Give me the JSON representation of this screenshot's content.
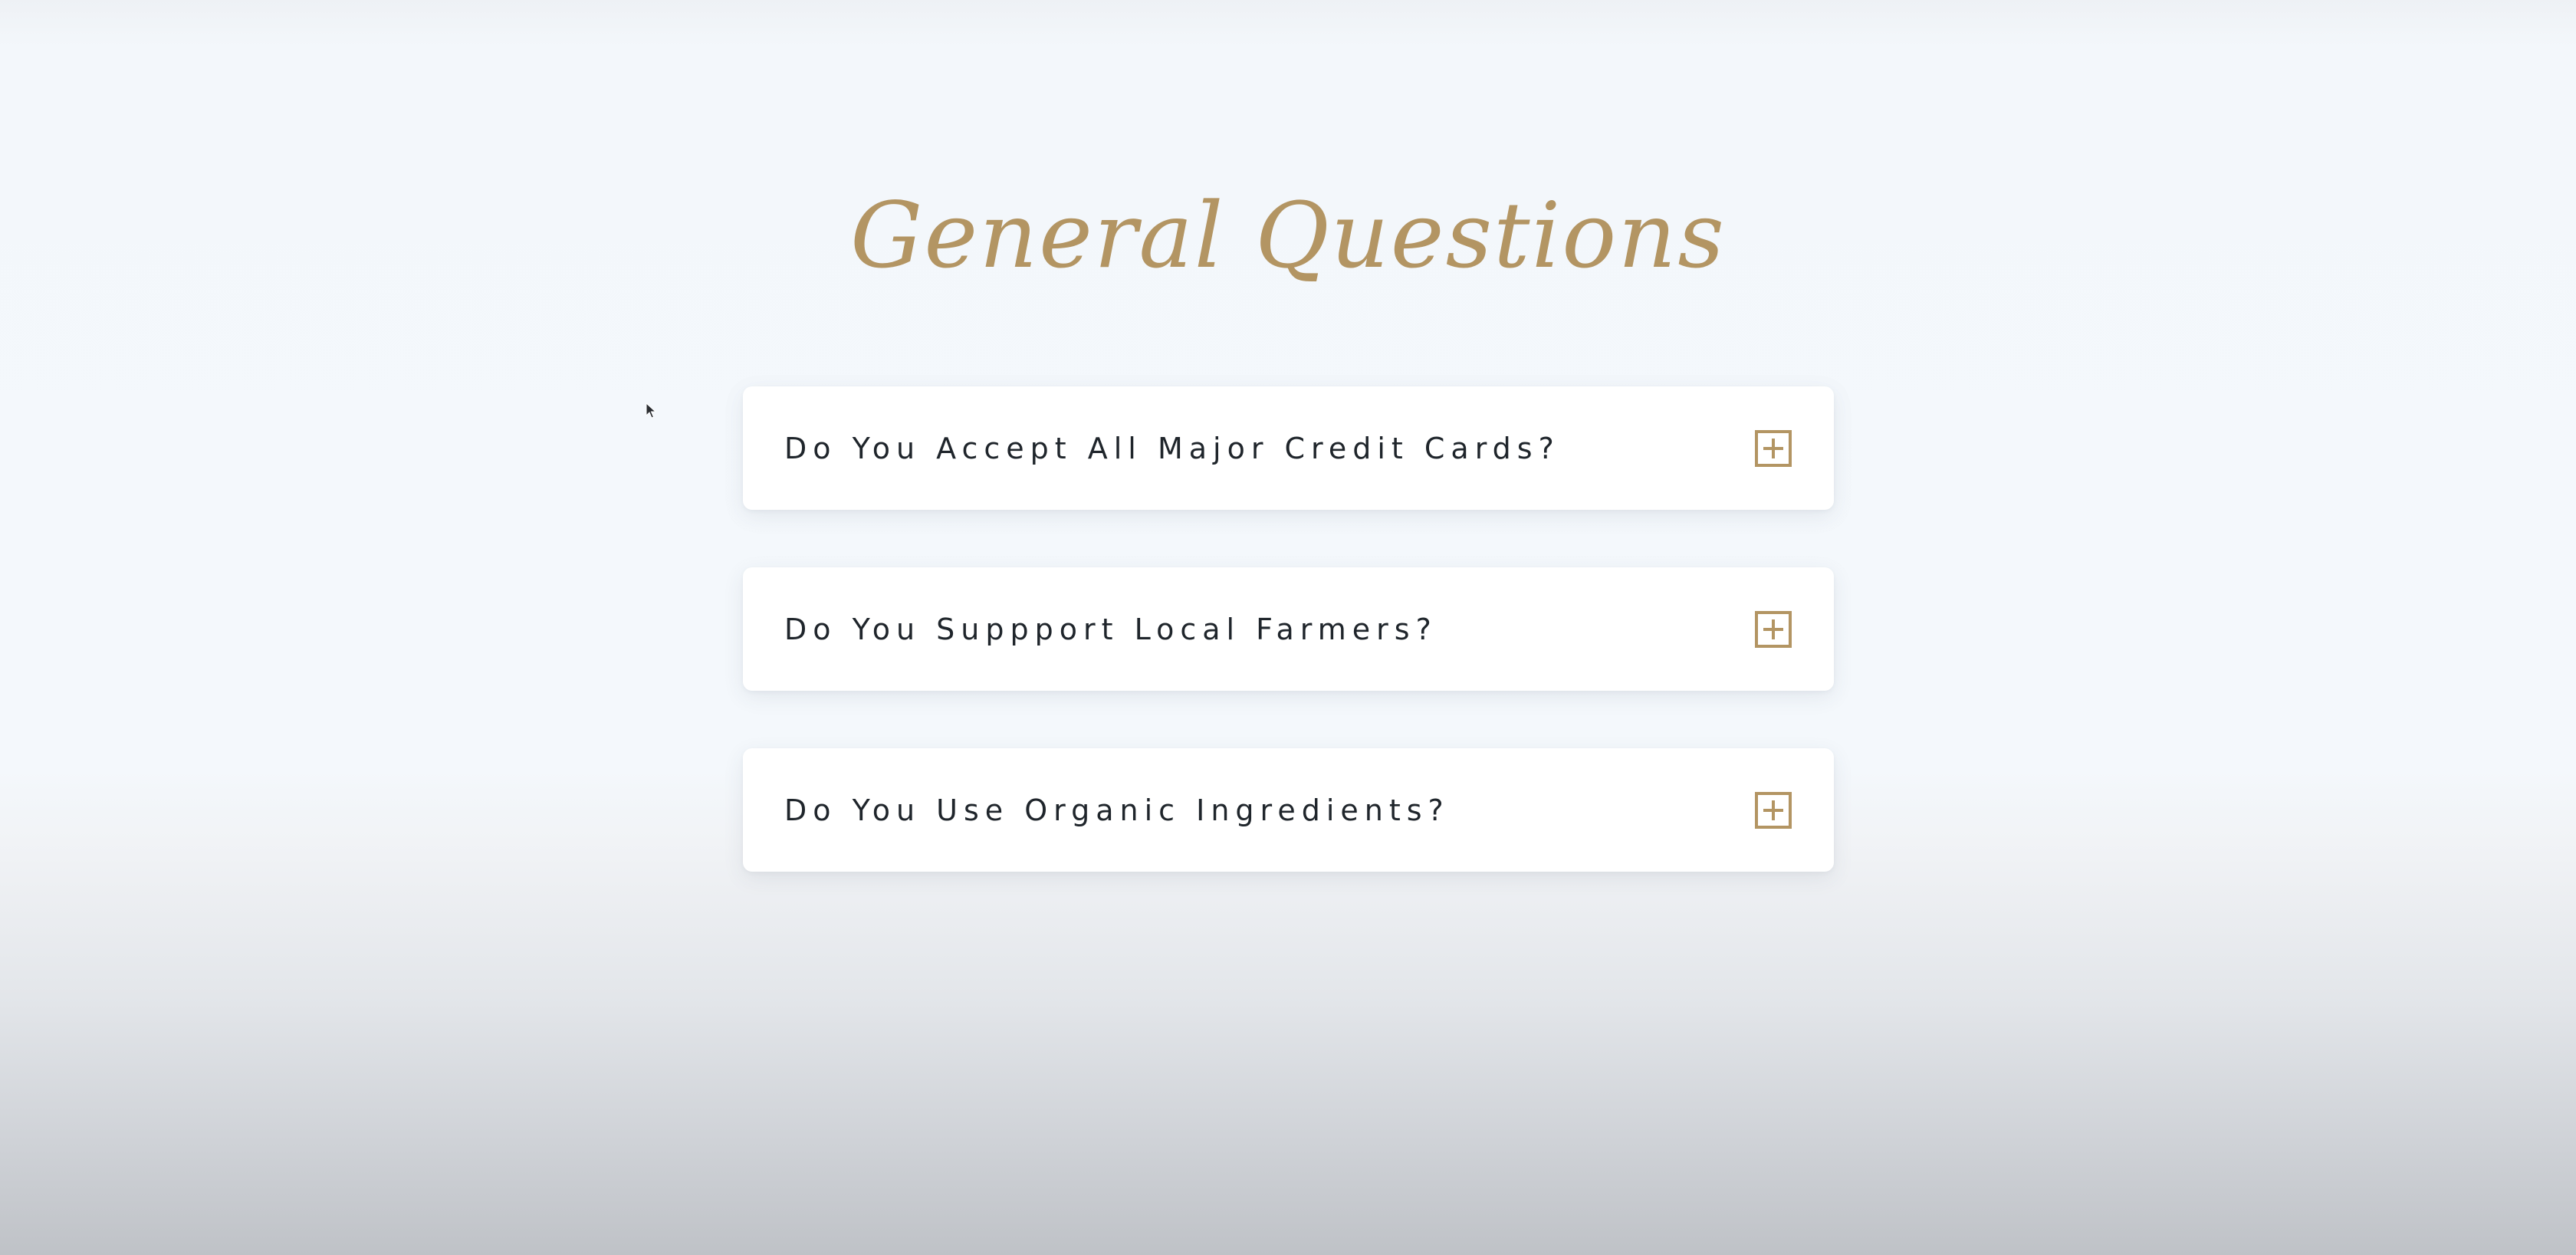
{
  "page": {
    "title": "General Questions"
  },
  "faq": {
    "items": [
      {
        "question": "Do You Accept All Major Credit Cards?",
        "toggle_icon": "plus-square-icon"
      },
      {
        "question": "Do You Suppport Local Farmers?",
        "toggle_icon": "plus-square-icon"
      },
      {
        "question": "Do You Use Organic Ingredients?",
        "toggle_icon": "plus-square-icon"
      }
    ]
  },
  "colors": {
    "accent": "#b39563",
    "question_text": "#1f252b",
    "card_background": "#ffffff",
    "page_background": "#f4f8fc"
  }
}
